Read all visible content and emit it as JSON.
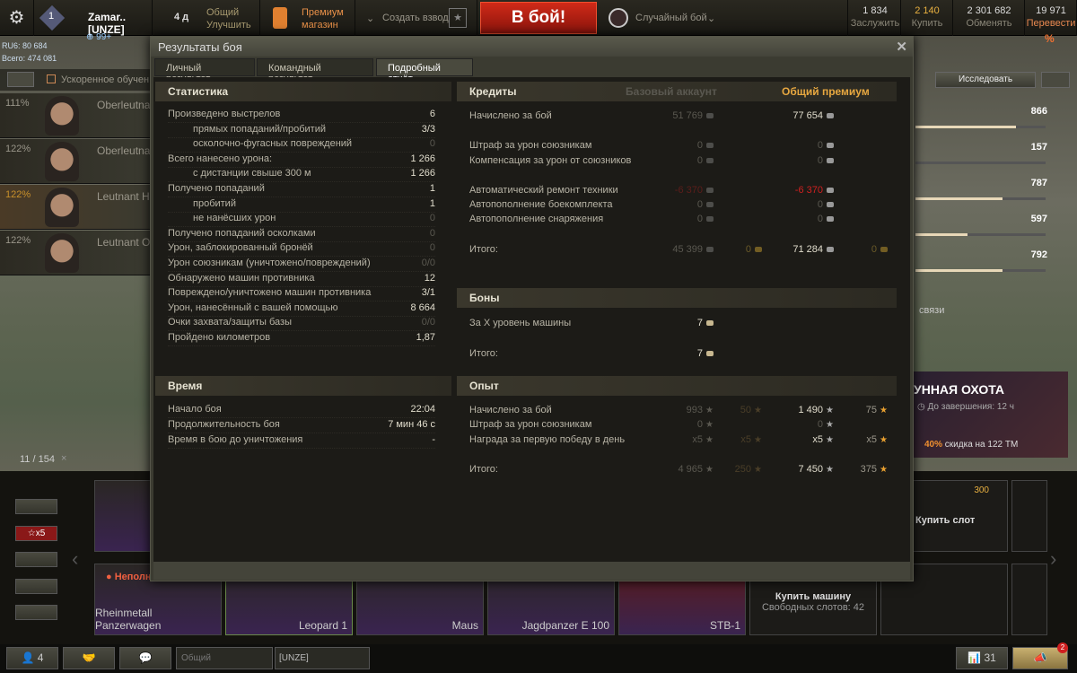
{
  "topbar": {
    "player": "Zamar..[UNZE]",
    "level": "1",
    "invites": "99+",
    "premium_days": "4 д",
    "premium_title": "Общий",
    "premium_action": "Улучшить",
    "shop_line1": "Премиум",
    "shop_line2": "магазин",
    "platoon": "Создать взвод",
    "battle": "В бой!",
    "battle_mode": "Случайный бой",
    "currencies": [
      {
        "value": "1 834",
        "label": "Заслужить"
      },
      {
        "value": "2 140",
        "label": "Купить"
      },
      {
        "value": "2 301 682",
        "label": "Обменять"
      },
      {
        "value": "19 971",
        "label": "Перевести"
      }
    ],
    "discount": "%"
  },
  "account": {
    "rating": "RU6: 80 684",
    "total": "Всего: 474 081"
  },
  "crew": {
    "accelerated": "Ускоренное обучен",
    "members": [
      {
        "pct": "111%",
        "name": "Oberleutnant"
      },
      {
        "pct": "122%",
        "name": "Oberleutnant"
      },
      {
        "pct": "122%",
        "name": "Leutnant Hos"
      },
      {
        "pct": "122%",
        "name": "Leutnant Opp"
      }
    ]
  },
  "counter": "11 / 154",
  "dialog": {
    "title": "Результаты боя",
    "tabs": [
      "Личный результат",
      "Командный результат",
      "Подробный отчёт"
    ],
    "stats": {
      "title": "Статистика",
      "rows": [
        {
          "label": "Произведено выстрелов",
          "value": "6"
        },
        {
          "label": "прямых попаданий/пробитий",
          "value": "3/3"
        },
        {
          "label": "осколочно-фугасных повреждений",
          "value": "0"
        },
        {
          "label": "Всего нанесено урона:",
          "value": "1 266"
        },
        {
          "label": "с дистанции свыше 300 м",
          "value": "1 266"
        },
        {
          "label": "Получено попаданий",
          "value": "1"
        },
        {
          "label": "пробитий",
          "value": "1"
        },
        {
          "label": "не нанёсших урон",
          "value": "0"
        },
        {
          "label": "Получено попаданий осколками",
          "value": "0"
        },
        {
          "label": "Урон, заблокированный бронёй",
          "value": "0"
        },
        {
          "label": "Урон союзникам (уничтожено/повреждений)",
          "value": "0/0"
        },
        {
          "label": "Обнаружено машин противника",
          "value": "12"
        },
        {
          "label": "Повреждено/уничтожено машин противника",
          "value": "3/1"
        },
        {
          "label": "Урон, нанесённый с вашей помощью",
          "value": "8 664"
        },
        {
          "label": "Очки захвата/защиты базы",
          "value": "0/0"
        },
        {
          "label": "Пройдено километров",
          "value": "1,87"
        }
      ]
    },
    "time": {
      "title": "Время",
      "rows": [
        {
          "label": "Начало боя",
          "value": "22:04"
        },
        {
          "label": "Продолжительность боя",
          "value": "7 мин 46 с"
        },
        {
          "label": "Время в бою до уничтожения",
          "value": "-"
        }
      ]
    },
    "credits": {
      "title": "Кредиты",
      "col_base": "Базовый аккаунт",
      "col_premium": "Общий премиум",
      "rows": [
        {
          "label": "Начислено за бой",
          "base": "51 769",
          "premium": "77 654"
        },
        {
          "label": "Штраф за урон союзникам",
          "base": "0",
          "premium": "0"
        },
        {
          "label": "Компенсация за урон от союзников",
          "base": "0",
          "premium": "0"
        },
        {
          "label": "Автоматический ремонт техники",
          "base": "-6 370",
          "premium": "-6 370"
        },
        {
          "label": "Автопополнение боекомплекта",
          "base": "0",
          "premium": "0"
        },
        {
          "label": "Автопополнение снаряжения",
          "base": "0",
          "premium": "0"
        },
        {
          "label": "Итого:",
          "base": "45 399",
          "base_gold": "0",
          "premium": "71 284",
          "premium_gold": "0"
        }
      ]
    },
    "bonds": {
      "title": "Боны",
      "rows": [
        {
          "label": "За X уровень машины",
          "value": "7"
        },
        {
          "label": "Итого:",
          "value": "7"
        }
      ]
    },
    "xp": {
      "title": "Опыт",
      "rows": [
        {
          "label": "Начислено за бой",
          "base": "993",
          "base_free": "50",
          "premium": "1 490",
          "premium_free": "75"
        },
        {
          "label": "Штраф за урон союзникам",
          "base": "0",
          "premium": "0"
        },
        {
          "label": "Награда за первую победу в день",
          "base": "x5",
          "base_free": "x5",
          "premium": "x5",
          "premium_free": "x5"
        },
        {
          "label": "Итого:",
          "base": "4 965",
          "base_free": "250",
          "premium": "7 450",
          "premium_free": "375"
        }
      ]
    }
  },
  "research": {
    "button": "Исследовать",
    "values": [
      "866",
      "157",
      "787",
      "597",
      "792"
    ],
    "fill": [
      0.77,
      0,
      0.67,
      0.4,
      0.67
    ],
    "link": "связи"
  },
  "event": {
    "title": "УННАЯ ОХОТА",
    "timer": "До завершения: 12 ч",
    "discount": "40%",
    "discount_text": "скидка на",
    "tank": "122 TM"
  },
  "carousel": {
    "crew_warning": "Неполный экипаж",
    "vehicles": [
      "Rheinmetall Panzerwagen",
      "Leopard 1",
      "Maus",
      "Jagdpanzer E 100",
      "STB-1"
    ],
    "buy_vehicle": "Купить машину",
    "free_slots": "Свободных слотов: 42",
    "buy_slot": "Купить слот",
    "slot_price": "300",
    "xp_multiplier": "x5"
  },
  "bottombar": {
    "friends": "4",
    "channel1": "Общий",
    "channel2": "[UNZE]",
    "sessions": "31",
    "notifications": "2"
  }
}
